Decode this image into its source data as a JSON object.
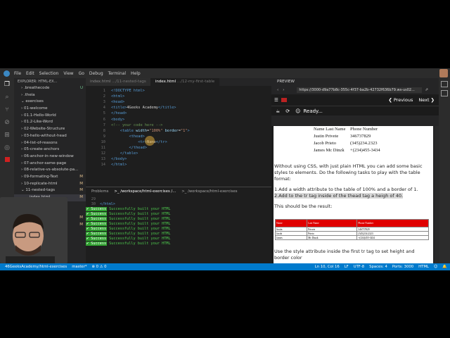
{
  "menubar": {
    "items": [
      "File",
      "Edit",
      "Selection",
      "View",
      "Go",
      "Debug",
      "Terminal",
      "Help"
    ]
  },
  "sidebar": {
    "header": "EXPLORER: HTML-EX...",
    "items": [
      {
        "label": "› .breathecode",
        "badge": "U"
      },
      {
        "label": "› .theia",
        "badge": ""
      },
      {
        "label": "⌄ exercises",
        "badge": ""
      },
      {
        "label": "› 01-welcome",
        "badge": ""
      },
      {
        "label": "› 01.1-Hello-World",
        "badge": ""
      },
      {
        "label": "› 01.2-Like-Word",
        "badge": ""
      },
      {
        "label": "› 02-Website-Structure",
        "badge": ""
      },
      {
        "label": "› 03-hello-without-head",
        "badge": ""
      },
      {
        "label": "› 04-list-of-reasons",
        "badge": ""
      },
      {
        "label": "› 05-create-anchors",
        "badge": ""
      },
      {
        "label": "› 06-anchor-in-new-window",
        "badge": ""
      },
      {
        "label": "› 07-anchor-same-page",
        "badge": ""
      },
      {
        "label": "› 08-relative-vs-absolute-pa...",
        "badge": ""
      },
      {
        "label": "› 09-formating-Text",
        "badge": "M"
      },
      {
        "label": "› 10-replicate-html",
        "badge": "M"
      },
      {
        "label": "⌄ 11-nested-tags",
        "badge": "M"
      },
      {
        "label": "index.html",
        "badge": "M"
      },
      {
        "label": "...md",
        "badge": ""
      },
      {
        "label": "",
        "badge": ""
      },
      {
        "label": "",
        "badge": "M"
      },
      {
        "label": "",
        "badge": "M"
      }
    ]
  },
  "tabs": [
    {
      "name": "index.html",
      "path": ".../11-nested-tags"
    },
    {
      "name": "index.html",
      "path": ".../12-my-first-table"
    }
  ],
  "editor": {
    "lines": [
      {
        "n": "1",
        "parts": [
          [
            "tg",
            "<!DOCTYPE html>"
          ]
        ]
      },
      {
        "n": "2",
        "parts": [
          [
            "tg",
            "<html>"
          ]
        ]
      },
      {
        "n": "3",
        "parts": [
          [
            "tg",
            "<head>"
          ]
        ]
      },
      {
        "n": "4",
        "parts": [
          [
            "tg",
            "<title>"
          ],
          [
            "tx",
            "4Geeks Academy"
          ],
          [
            "tg",
            "</title>"
          ]
        ]
      },
      {
        "n": "5",
        "parts": [
          [
            "tg",
            "</head>"
          ]
        ]
      },
      {
        "n": "6",
        "parts": [
          [
            "tg",
            "<body>"
          ]
        ]
      },
      {
        "n": "7",
        "parts": [
          [
            "cm",
            "<!-- your code here -->"
          ]
        ]
      },
      {
        "n": "8",
        "parts": [
          [
            "tx",
            "    "
          ],
          [
            "tg",
            "<table "
          ],
          [
            "at",
            "width"
          ],
          [
            "tx",
            "="
          ],
          [
            "st",
            "\"100%\""
          ],
          [
            "at",
            " border"
          ],
          [
            "tx",
            "="
          ],
          [
            "st",
            "\"1\""
          ],
          [
            "tg",
            ">"
          ]
        ]
      },
      {
        "n": "9",
        "parts": [
          [
            "tx",
            "        "
          ],
          [
            "tg",
            "<thead>"
          ]
        ]
      },
      {
        "n": "10",
        "parts": [
          [
            "tx",
            "            "
          ],
          [
            "tg",
            "<tr>"
          ],
          [
            "tx",
            "Name"
          ],
          [
            "tg",
            "</tr>"
          ]
        ]
      },
      {
        "n": "11",
        "parts": [
          [
            "tx",
            "        "
          ],
          [
            "tg",
            "</thead>"
          ]
        ]
      },
      {
        "n": "12",
        "parts": [
          [
            "tx",
            "    "
          ],
          [
            "tg",
            "</table>"
          ]
        ]
      },
      {
        "n": "13",
        "parts": [
          [
            "tg",
            "</body>"
          ]
        ]
      },
      {
        "n": "14",
        "parts": [
          [
            "tg",
            "</html>"
          ]
        ]
      }
    ]
  },
  "panel": {
    "tabs": [
      "Problems",
      ">_ /workspace/html-exercises /...",
      ">_ /workspace/html-exercises"
    ],
    "pre_lines": [
      {
        "n": "29",
        "text": ""
      },
      {
        "n": "30",
        "text": "</html>"
      }
    ],
    "success_badge": "✔ Success",
    "success_text": "Successfully built your HTML",
    "success_count": 8
  },
  "preview": {
    "title": "PREVIEW",
    "url": "https://3000-d9a77b8c-355c-4f37-ba2b-42732f636b79.ws-us02...",
    "previous": "❮ Previous",
    "next": "Next ❯",
    "ready": "Ready...",
    "sample_rows": [
      [
        "Name Last Name",
        "Phone Number"
      ],
      [
        "Justin  Privete",
        "346737829"
      ],
      [
        "Jacob  Prieto",
        "(345)234.2323"
      ],
      [
        "James  Mc Dinzk",
        "+(234)455-3434"
      ]
    ],
    "lesson_intro": "Without using CSS, with just plain HTML you can add some basic styles to elements. Do the following tasks to play with the table format:",
    "task1": "1.Add a width attribute to the table of 100% and a border of 1.",
    "task2": "2.Add to the tr tag inside of the thead tag a heigh of 40.",
    "result_label": "This should be the result:",
    "result_table": [
      [
        "Name",
        "Last Name",
        "Phone Number"
      ],
      [
        "Justin",
        "Privete",
        "346737829"
      ],
      [
        "Jacob",
        "Prieto",
        "(345)234.2323"
      ],
      [
        "James",
        "Mc Dinzk",
        "+(234)455-3434"
      ]
    ],
    "after_text": "Use the style attribute inside the first tr tag to set height and border color"
  },
  "status": {
    "left": [
      "46GeeksAcademy/html-exercises",
      "master*",
      "⊗ 0 ⚠ 0"
    ],
    "right": [
      "Ln 10, Col 16",
      "LF",
      "UTF-8",
      "Spaces: 4",
      "Ports: 3000",
      "HTML",
      "☺",
      "🔔"
    ]
  },
  "colors": {
    "accent": "#007acc",
    "success": "#2ea02e",
    "result_header": "#e00000"
  }
}
